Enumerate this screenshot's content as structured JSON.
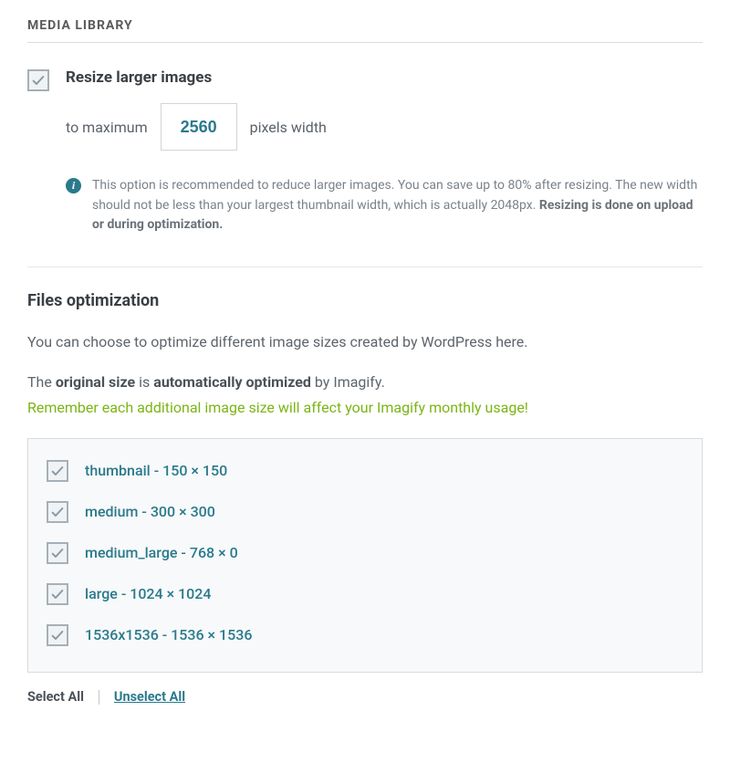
{
  "section_title": "MEDIA LIBRARY",
  "resize": {
    "label": "Resize larger images",
    "prefix": "to maximum",
    "value": "2560",
    "suffix": "pixels width",
    "info_text_1": "This option is recommended to reduce larger images. You can save up to 80% after resizing. The new width should not be less than your largest thumbnail width, which is actually 2048px. ",
    "info_bold": "Resizing is done on upload or during optimization."
  },
  "files_opt": {
    "heading": "Files optimization",
    "desc1": "You can choose to optimize different image sizes created by WordPress here.",
    "desc2_pre": "The ",
    "desc2_b1": "original size",
    "desc2_mid": " is ",
    "desc2_b2": "automatically optimized",
    "desc2_post": " by Imagify.",
    "warning": "Remember each additional image size will affect your Imagify monthly usage!",
    "sizes": [
      "thumbnail - 150 × 150",
      "medium - 300 × 300",
      "medium_large - 768 × 0",
      "large - 1024 × 1024",
      "1536x1536 - 1536 × 1536"
    ],
    "select_all": "Select All",
    "unselect_all": "Unselect All"
  }
}
